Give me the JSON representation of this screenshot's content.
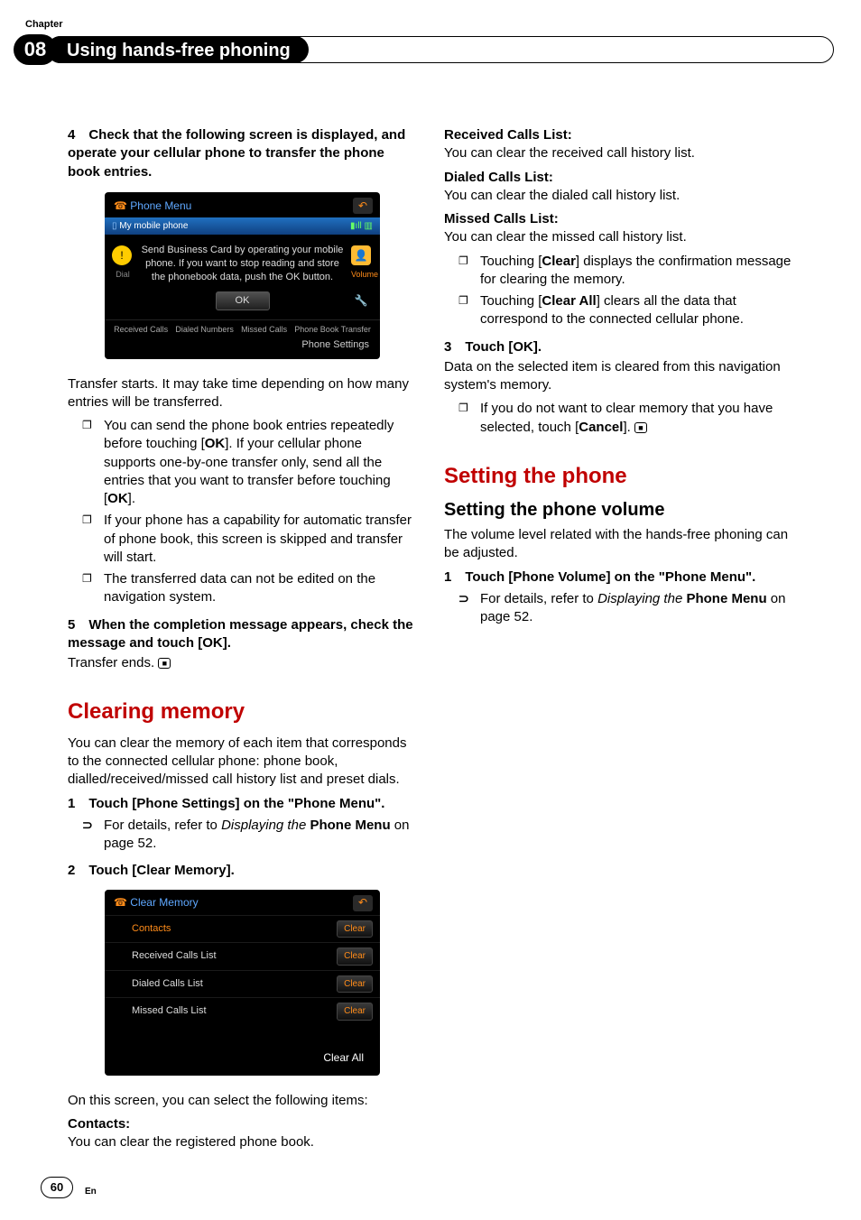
{
  "chapter_label": "Chapter",
  "chapter_num": "08",
  "page_title": "Using hands-free phoning",
  "left": {
    "step4": "4 Check that the following screen is displayed, and operate your cellular phone to transfer the phone book entries.",
    "ss1": {
      "title": "Phone Menu",
      "sub_left": "My mobile phone",
      "dial": "Dial",
      "volume": "Volume",
      "msg": "Send Business Card by operating your mobile phone. If you want to stop reading and store the phonebook data, push the OK button.",
      "ok": "OK",
      "tab1": "Received Calls",
      "tab2": "Dialed Numbers",
      "tab3": "Missed Calls",
      "tab4": "Phone Book Transfer",
      "bottom": "Phone Settings"
    },
    "after_ss1": "Transfer starts. It may take time depending on how many entries will be transferred.",
    "note1": "You can send the phone book entries repeatedly before touching [",
    "ok1": "OK",
    "note1b": "]. If your cellular phone supports one-by-one transfer only, send all the entries that you want to transfer before touching [",
    "ok2": "OK",
    "note1c": "].",
    "note2": "If your phone has a capability for automatic transfer of phone book, this screen is skipped and transfer will start.",
    "note3": "The transferred data can not be edited on the navigation system.",
    "step5": "5 When the completion message appears, check the message and touch [OK].",
    "step5_after": "Transfer ends.",
    "h2_clear": "Clearing memory",
    "clear_para": "You can clear the memory of each item that corresponds to the connected cellular phone: phone book, dialled/received/missed call history list and preset dials.",
    "step1": "1 Touch [Phone Settings] on the \"Phone Menu\".",
    "ref1a": "For details, refer to ",
    "ref1b": "Displaying the ",
    "ref1c": "Phone Menu",
    "ref1d": " on page 52."
  },
  "right": {
    "step2": "2 Touch [Clear Memory].",
    "ss2": {
      "title": "Clear Memory",
      "r1": "Contacts",
      "r2": "Received Calls List",
      "r3": "Dialed Calls List",
      "r4": "Missed Calls List",
      "clear": "Clear",
      "clear_all": "Clear All"
    },
    "after_ss2": "On this screen, you can select the following items:",
    "h_contacts": "Contacts:",
    "p_contacts": "You can clear the registered phone book.",
    "h_recv": "Received Calls List:",
    "p_recv": "You can clear the received call history list.",
    "h_dial": "Dialed Calls List:",
    "p_dial": "You can clear the dialed call history list.",
    "h_miss": "Missed Calls List:",
    "p_miss": "You can clear the missed call history list.",
    "rn1a": "Touching [",
    "rn1b": "Clear",
    "rn1c": "] displays the confirmation message for clearing the memory.",
    "rn2a": "Touching [",
    "rn2b": "Clear All",
    "rn2c": "] clears all the data that correspond to the connected cellular phone.",
    "step3": "3 Touch [OK].",
    "step3_p": "Data on the selected item is cleared from this navigation system's memory.",
    "rn3a": "If you do not want to clear memory that you have selected, touch [",
    "rn3b": "Cancel",
    "rn3c": "].",
    "h2_set": "Setting the phone",
    "h3_vol": "Setting the phone volume",
    "vol_p": "The volume level related with the hands-free phoning can be adjusted.",
    "vstep1": "1 Touch [Phone Volume] on the \"Phone Menu\".",
    "vref1a": "For details, refer to ",
    "vref1b": "Displaying the ",
    "vref1c": "Phone Menu",
    "vref1d": " on page 52."
  },
  "page_num": "60",
  "page_lang": "En"
}
